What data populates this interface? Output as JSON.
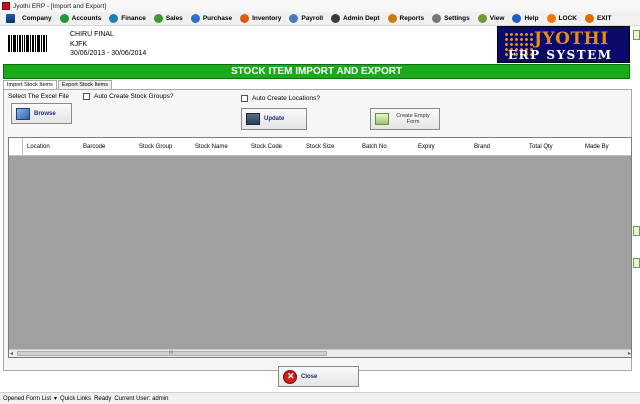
{
  "window": {
    "title": "Jyothi ERP - [Import and Export]"
  },
  "menu": {
    "items": [
      "Company",
      "Accounts",
      "Finance",
      "Sales",
      "Purchase",
      "Inventory",
      "Payroll",
      "Admin Dept",
      "Reports",
      "Settings",
      "View",
      "Help"
    ],
    "lock": "LOCK",
    "exit": "EXIT"
  },
  "company": {
    "name": "CHIRU FINAL",
    "code": "KJFK",
    "period": "30/06/2013 - 30/06/2014"
  },
  "logo": {
    "line1": "JYOTHI",
    "line2": "ERP SYSTEM"
  },
  "heading": "STOCK ITEM IMPORT AND EXPORT",
  "tabs": [
    "Import Stock Items",
    "Export Stock Items"
  ],
  "form": {
    "select_label": "Select The Excel File",
    "auto_groups_label": "Auto Create Stock Groups?",
    "auto_locations_label": "Auto Create Locations?",
    "browse": "Browse",
    "update": "Update",
    "create_empty": "Create Empty Form"
  },
  "grid": {
    "columns": [
      "Location",
      "Barcode",
      "Stock Group",
      "Stock Name",
      "Stock Code",
      "Stock Size",
      "Batch No",
      "Expiry",
      "Brand",
      "Total Qty",
      "Made By"
    ],
    "scroll_grip": "III"
  },
  "close_label": "Close",
  "status": {
    "opened_forms": "Opened Form List",
    "quick_links": "Quick Links",
    "ready": "Ready",
    "user": "Current User: admin"
  }
}
